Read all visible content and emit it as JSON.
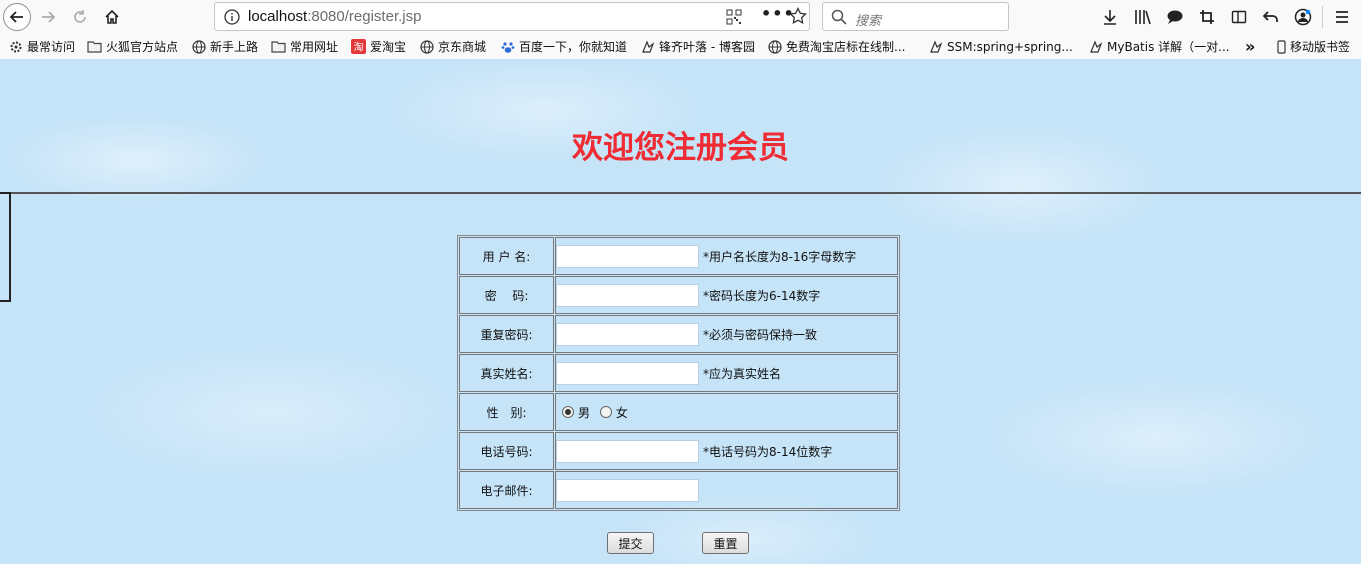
{
  "browser": {
    "url_host": "localhost",
    "url_port": ":8080",
    "url_path": "/register.jsp",
    "search_placeholder": "搜索",
    "more_label": "•••"
  },
  "bookmarks": [
    {
      "label": "最常访问",
      "icon": "gear-icon"
    },
    {
      "label": "火狐官方站点",
      "icon": "folder-icon"
    },
    {
      "label": "新手上路",
      "icon": "globe-icon"
    },
    {
      "label": "常用网址",
      "icon": "folder-icon"
    },
    {
      "label": "爱淘宝",
      "icon": "taobao-icon"
    },
    {
      "label": "京东商城",
      "icon": "globe-icon"
    },
    {
      "label": "百度一下，你就知道",
      "icon": "baidu-paw-icon"
    },
    {
      "label": "锋齐叶落 - 博客园",
      "icon": "blog-icon"
    },
    {
      "label": "免费淘宝店标在线制...",
      "icon": "globe-icon"
    },
    {
      "label": "SSM:spring+spring...",
      "icon": "blog-icon"
    },
    {
      "label": "MyBatis 详解（一对...",
      "icon": "blog-icon"
    }
  ],
  "bookmarks_overflow": "»",
  "mobile_bookmarks": "移动版书签",
  "page": {
    "title": "欢迎您注册会员",
    "rows": [
      {
        "label": "用 户 名:",
        "hint": "*用户名长度为8-16字母数字"
      },
      {
        "label": "密　 码:",
        "hint": "*密码长度为6-14数字"
      },
      {
        "label": "重复密码:",
        "hint": "*必须与密码保持一致"
      },
      {
        "label": "真实姓名:",
        "hint": "*应为真实姓名"
      },
      {
        "label": "性　别:",
        "hint": ""
      },
      {
        "label": "电话号码:",
        "hint": "*电话号码为8-14位数字"
      },
      {
        "label": "电子邮件:",
        "hint": ""
      }
    ],
    "gender": {
      "male": "男",
      "female": "女",
      "selected": "男"
    },
    "submit_label": "提交",
    "reset_label": "重置"
  }
}
